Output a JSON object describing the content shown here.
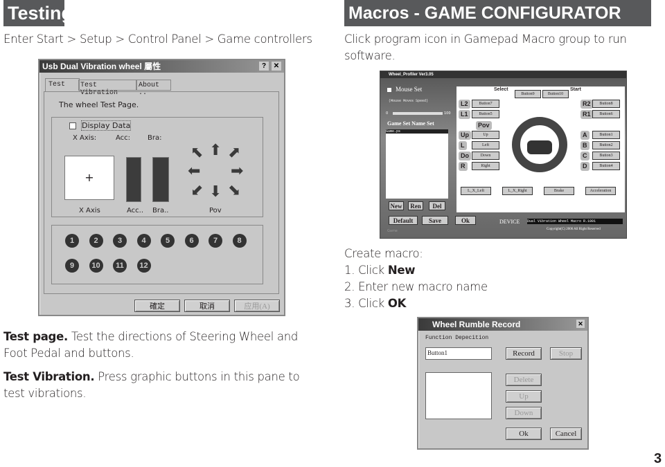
{
  "left": {
    "heading": "Testing",
    "path": "Enter Start > Setup > Control Panel > Game controllers",
    "dialog": {
      "title": "Usb Dual Vibration wheel 屬性",
      "help": "?",
      "close": "✕",
      "tabs": [
        "Test",
        "Test Vibration",
        "About .."
      ],
      "caption": "The wheel Test Page.",
      "display_data": "Display Data",
      "top_labels": [
        "X Axis:",
        "Acc:",
        "Bra:"
      ],
      "bottom_labels": [
        "X Axis",
        "Acc..",
        "Bra..",
        "Pov"
      ],
      "buttons": [
        "1",
        "2",
        "3",
        "4",
        "5",
        "6",
        "7",
        "8",
        "9",
        "10",
        "11",
        "12"
      ],
      "ok": "確定",
      "cancel": "取消",
      "apply": "应用(A)"
    },
    "para1_bold": "Test page.",
    "para1": " Test the directions of Steering Wheel and Foot Pedal and buttons.",
    "para2_bold": "Test Vibration.",
    "para2": " Press graphic buttons in this pane to test vibrations."
  },
  "right": {
    "heading": "Macros - GAME CONFIGURATOR SOFTWARE",
    "intro": "Click program icon in Gamepad Macro group to run software.",
    "profiler": {
      "title": "Wheel_Profiler Ver3.05",
      "mouse_set": "Mouse Set",
      "mouse_speed": "(Mouse Moves Speed)",
      "slider_min": "0",
      "slider_max": "100",
      "slider_value": 0,
      "game_set_label": "Game Set Name Set",
      "game_list": [
        "Game.ps"
      ],
      "select": "Select",
      "start": "Start",
      "select_buttons": [
        "Button9",
        "Button10"
      ],
      "left_shoulder": [
        {
          "k": "L2",
          "v": "Button7"
        },
        {
          "k": "L1",
          "v": "Button5"
        }
      ],
      "right_shoulder": [
        {
          "k": "R2",
          "v": "Button8"
        },
        {
          "k": "R1",
          "v": "Button6"
        }
      ],
      "pov": "Pov",
      "pov_buttons": [
        {
          "k": "Up",
          "v": "Up"
        },
        {
          "k": "L",
          "v": "Left"
        },
        {
          "k": "Do",
          "v": "Down"
        },
        {
          "k": "R",
          "v": "Right"
        }
      ],
      "face_buttons": [
        {
          "k": "A",
          "v": "Button1"
        },
        {
          "k": "B",
          "v": "Button2"
        },
        {
          "k": "C",
          "v": "Button3"
        },
        {
          "k": "D",
          "v": "Button4"
        }
      ],
      "axes": [
        "L_X_Left",
        "L_X_Right",
        "Brake",
        "Acceleration"
      ],
      "new": "New",
      "ren": "Ren",
      "del": "Del",
      "default": "Default",
      "save": "Save",
      "ok": "Ok",
      "device_label": "DEVICE",
      "device_value": "Dual Vibration Wheel Macro R.1001",
      "game": "Game",
      "copyright": "Copyright(C) 2006 All Right Reserved"
    },
    "steps_title": "Create macro:",
    "steps": [
      {
        "n": "1.",
        "t": "Click ",
        "b": "New"
      },
      {
        "n": "2.",
        "t": "Enter new macro name",
        "b": ""
      },
      {
        "n": "3.",
        "t": "Click ",
        "b": "OK"
      }
    ],
    "rumble": {
      "title": "Wheel Rumble Record",
      "close": "✕",
      "label": "Function Depecition",
      "input_value": "Button1",
      "record": "Record",
      "stop": "Stop",
      "delete": "Delete",
      "up": "Up",
      "down": "Down",
      "ok": "Ok",
      "cancel": "Cancel"
    }
  },
  "page_number": "3"
}
